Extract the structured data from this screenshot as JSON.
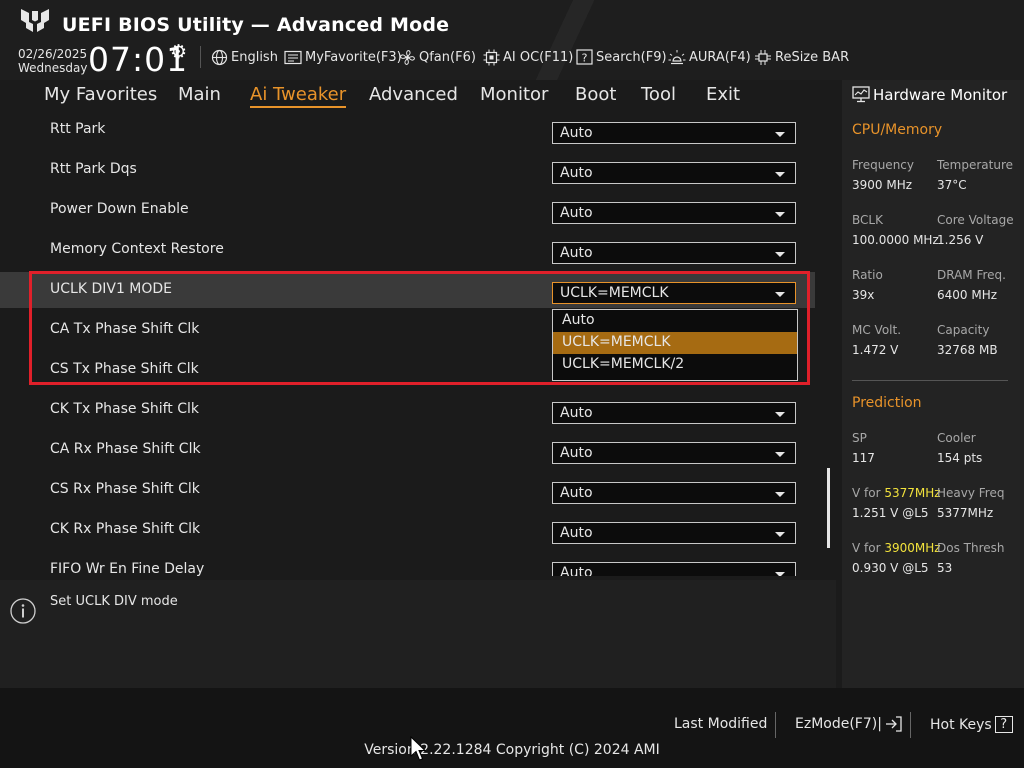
{
  "header": {
    "title": "UEFI BIOS Utility — Advanced Mode",
    "date": "02/26/2025",
    "weekday": "Wednesday",
    "time": "07:01",
    "tools": [
      {
        "label": "English",
        "icon": "globe-icon"
      },
      {
        "label": "MyFavorite(F3)",
        "icon": "favorite-icon"
      },
      {
        "label": "Qfan(F6)",
        "icon": "fan-icon"
      },
      {
        "label": "AI OC(F11)",
        "icon": "ai-oc-icon"
      },
      {
        "label": "Search(F9)",
        "icon": "search-icon"
      },
      {
        "label": "AURA(F4)",
        "icon": "aura-icon"
      },
      {
        "label": "ReSize BAR",
        "icon": "resize-bar-icon"
      }
    ]
  },
  "menu": {
    "items": [
      "My Favorites",
      "Main",
      "Ai Tweaker",
      "Advanced",
      "Monitor",
      "Boot",
      "Tool",
      "Exit"
    ],
    "active": "Ai Tweaker"
  },
  "settings": [
    {
      "label": "Rtt Park",
      "value": "Auto"
    },
    {
      "label": "Rtt Park Dqs",
      "value": "Auto"
    },
    {
      "label": "Power Down Enable",
      "value": "Auto"
    },
    {
      "label": "Memory Context Restore",
      "value": "Auto"
    },
    {
      "label": "UCLK DIV1 MODE",
      "value": "UCLK=MEMCLK"
    },
    {
      "label": "CA Tx Phase Shift Clk",
      "value": ""
    },
    {
      "label": "CS Tx Phase Shift Clk",
      "value": ""
    },
    {
      "label": "CK Tx Phase Shift Clk",
      "value": "Auto"
    },
    {
      "label": "CA Rx Phase Shift Clk",
      "value": "Auto"
    },
    {
      "label": "CS Rx Phase Shift Clk",
      "value": "Auto"
    },
    {
      "label": "CK Rx Phase Shift Clk",
      "value": "Auto"
    },
    {
      "label": "FIFO Wr En Fine Delay",
      "value": "Auto"
    }
  ],
  "dropdown": {
    "options": [
      "Auto",
      "UCLK=MEMCLK",
      "UCLK=MEMCLK/2"
    ],
    "highlighted": "UCLK=MEMCLK"
  },
  "help": {
    "text": "Set UCLK DIV mode"
  },
  "hardware_monitor": {
    "title": "Hardware Monitor",
    "cpu_memory": {
      "heading": "CPU/Memory",
      "frequency_label": "Frequency",
      "frequency": "3900 MHz",
      "temperature_label": "Temperature",
      "temperature": "37°C",
      "bclk_label": "BCLK",
      "bclk": "100.0000 MHz",
      "core_voltage_label": "Core Voltage",
      "core_voltage": "1.256 V",
      "ratio_label": "Ratio",
      "ratio": "39x",
      "dram_freq_label": "DRAM Freq.",
      "dram_freq": "6400 MHz",
      "mc_volt_label": "MC Volt.",
      "mc_volt": "1.472 V",
      "capacity_label": "Capacity",
      "capacity": "32768 MB"
    },
    "prediction": {
      "heading": "Prediction",
      "sp_label": "SP",
      "sp": "117",
      "cooler_label": "Cooler",
      "cooler": "154 pts",
      "v_for_1_prefix": "V for ",
      "v_for_1_freq": "5377MHz",
      "v_for_1": "1.251 V @L5",
      "heavy_freq_label": "Heavy Freq",
      "heavy_freq": "5377MHz",
      "v_for_2_prefix": "V for ",
      "v_for_2_freq": "3900MHz",
      "v_for_2": "0.930 V @L5",
      "dos_thresh_label": "Dos Thresh",
      "dos_thresh": "53"
    }
  },
  "footer": {
    "last_modified": "Last Modified",
    "ezmode": "EzMode(F7)|",
    "hot_keys": "Hot Keys",
    "hot_keys_icon_text": "?",
    "version": "Version 2.22.1284 Copyright (C) 2024 AMI"
  },
  "colors": {
    "accent": "#e8932a",
    "highlight_box": "#e0202a",
    "option_highlight": "#a66b12",
    "freq_highlight": "#f2e23c"
  }
}
